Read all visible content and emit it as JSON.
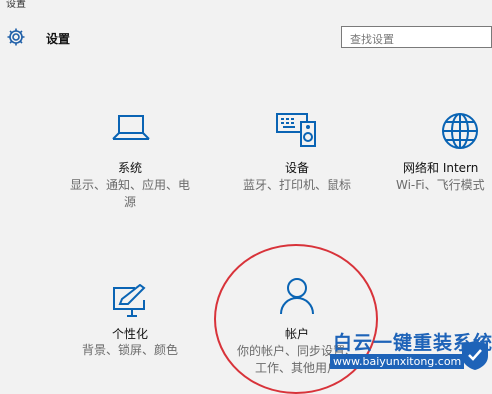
{
  "window": {
    "title": "设置"
  },
  "header": {
    "title": "设置",
    "gear_icon": "gear-icon"
  },
  "search": {
    "placeholder": "查找设置"
  },
  "tiles": [
    {
      "icon": "laptop-icon",
      "name": "系统",
      "desc_line1": "显示、通知、应用、电",
      "desc_line2": "源"
    },
    {
      "icon": "devices-icon",
      "name": "设备",
      "desc_line1": "蓝牙、打印机、鼠标",
      "desc_line2": ""
    },
    {
      "icon": "globe-icon",
      "name": "网络和 Intern",
      "desc_line1": "Wi-Fi、飞行模式",
      "desc_line2": ""
    },
    {
      "icon": "personalization-icon",
      "name": "个性化",
      "desc_line1": "背景、锁屏、颜色",
      "desc_line2": ""
    },
    {
      "icon": "person-icon",
      "name": "帐户",
      "desc_line1": "你的帐户、同步设置、",
      "desc_line2": "工作、其他用户"
    }
  ],
  "watermark": {
    "text": "白云一键重装系统",
    "url": "www.baiyunxitong.com"
  },
  "colors": {
    "accent": "#0a64b4",
    "highlight": "#d8333a",
    "watermark": "#1e63b8"
  }
}
